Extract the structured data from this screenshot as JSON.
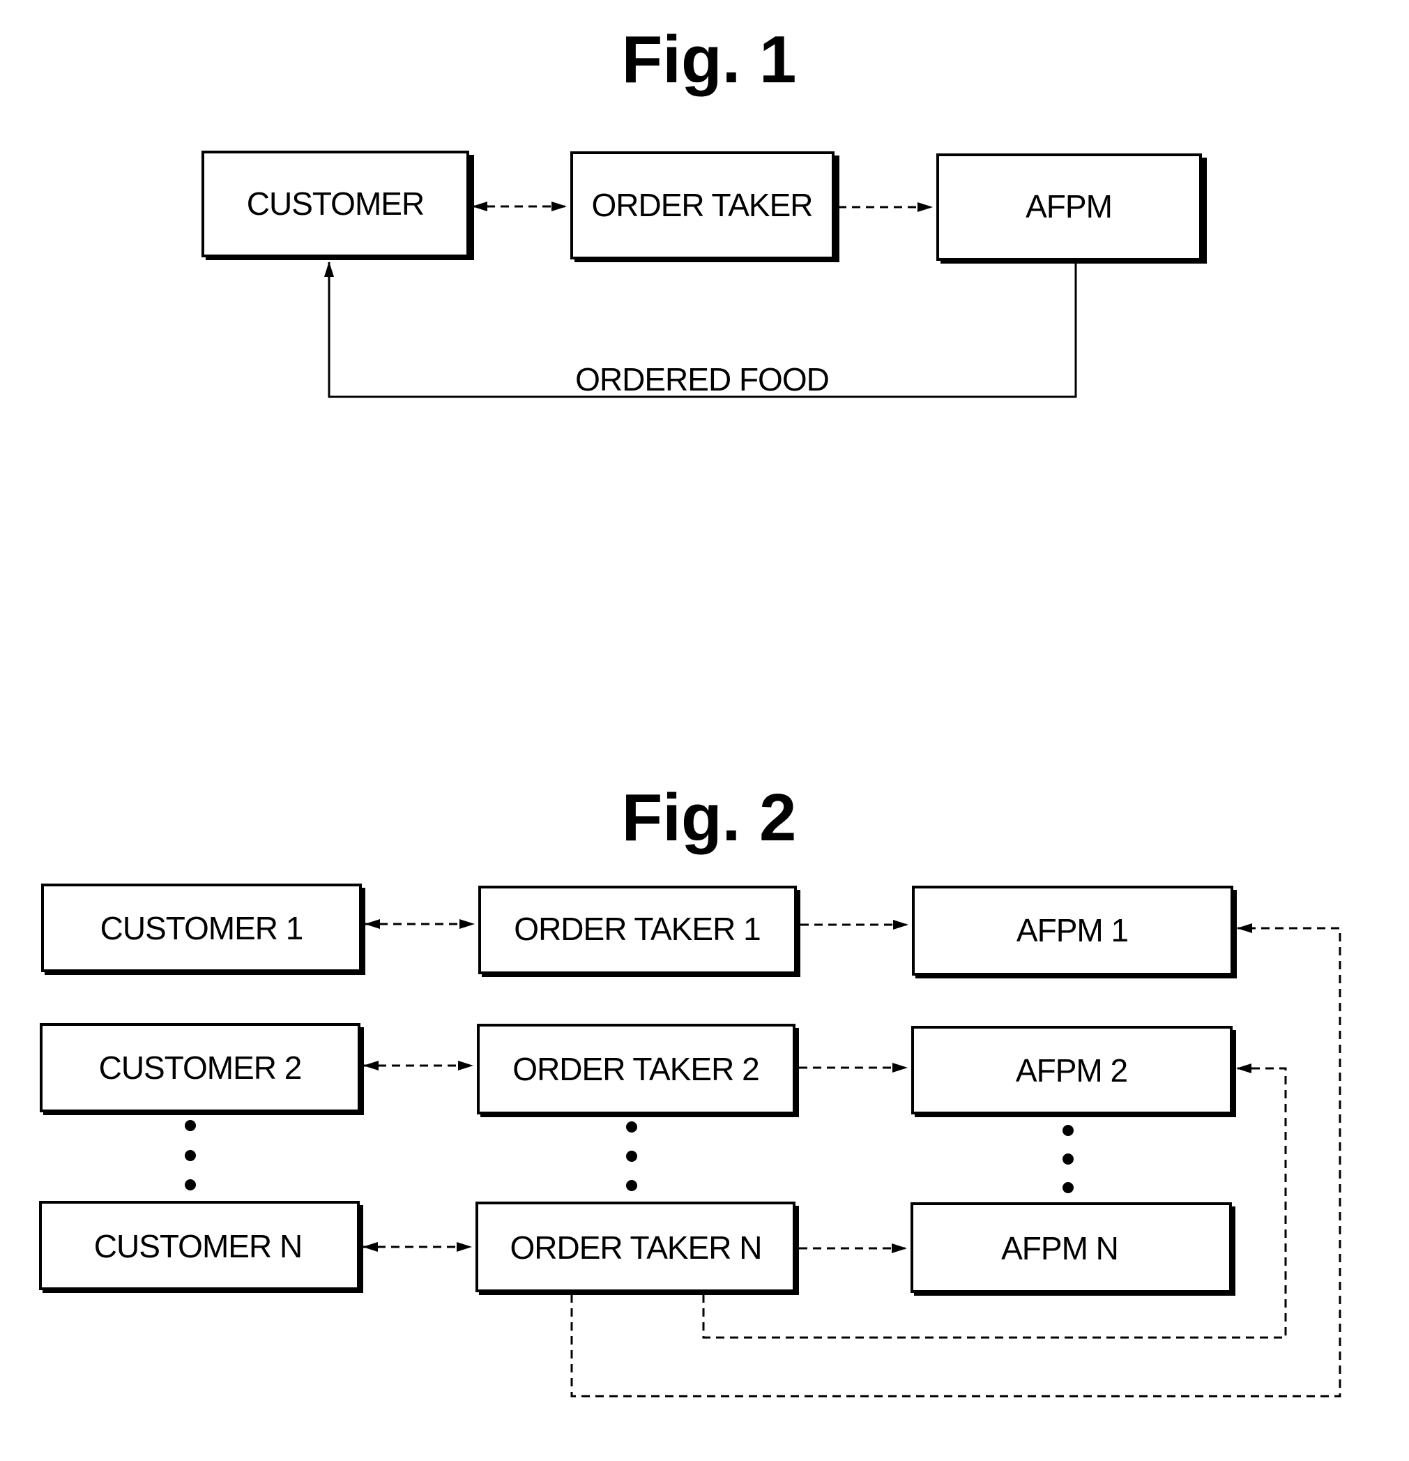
{
  "figures": [
    {
      "title": "Fig. 1",
      "boxes": [
        {
          "id": "customer",
          "label": "CUSTOMER"
        },
        {
          "id": "order-taker",
          "label": "ORDER TAKER"
        },
        {
          "id": "afpm",
          "label": "AFPM"
        }
      ],
      "connections": [
        {
          "from": "customer",
          "to": "order-taker",
          "style": "dashed",
          "direction": "bidirectional"
        },
        {
          "from": "order-taker",
          "to": "afpm",
          "style": "dashed",
          "direction": "forward"
        },
        {
          "from": "afpm",
          "to": "customer",
          "style": "solid",
          "direction": "forward",
          "label": "ORDERED FOOD"
        }
      ]
    },
    {
      "title": "Fig. 2",
      "rows": [
        {
          "customer": "CUSTOMER 1",
          "order_taker": "ORDER TAKER 1",
          "afpm": "AFPM 1"
        },
        {
          "customer": "CUSTOMER 2",
          "order_taker": "ORDER TAKER 2",
          "afpm": "AFPM 2"
        },
        {
          "customer": "CUSTOMER N",
          "order_taker": "ORDER TAKER N",
          "afpm": "AFPM N"
        }
      ],
      "ellipsis": "vertical dots between row 2 and row N in each column",
      "connections": [
        {
          "from": "CUSTOMER i",
          "to": "ORDER TAKER i",
          "style": "dashed",
          "direction": "bidirectional"
        },
        {
          "from": "ORDER TAKER i",
          "to": "AFPM i",
          "style": "dashed",
          "direction": "forward"
        },
        {
          "from": "ORDER TAKER N",
          "to": "AFPM 2",
          "style": "dashed",
          "direction": "forward"
        },
        {
          "from": "ORDER TAKER N",
          "to": "AFPM 1",
          "style": "dashed",
          "direction": "forward"
        }
      ]
    }
  ]
}
